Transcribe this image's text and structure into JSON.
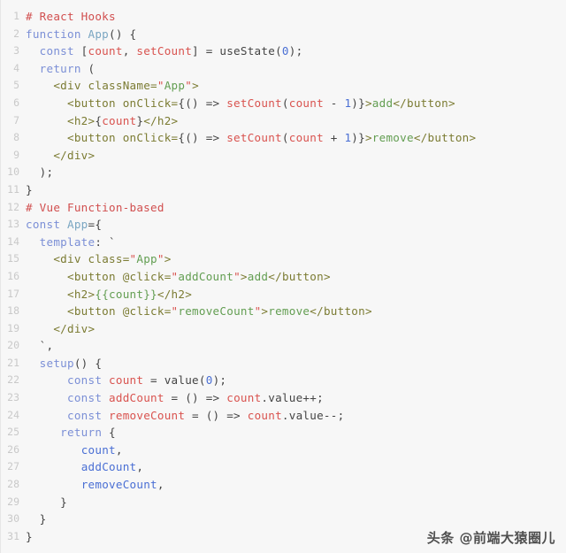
{
  "editor": {
    "language": "javascript",
    "background_color": "#f7f7f7",
    "line_number_color": "#c9c9c9",
    "default_text_color": "#404040",
    "total_lines": 31
  },
  "watermark": {
    "text": "头条 @前端大猿圈儿"
  },
  "lines": [
    {
      "n": "1",
      "tokens": [
        {
          "t": "# React Hooks",
          "c": "t-com"
        }
      ]
    },
    {
      "n": "2",
      "tokens": [
        {
          "t": "function ",
          "c": "t-kw"
        },
        {
          "t": "App",
          "c": "t-fnname"
        },
        {
          "t": "() {",
          "c": "t-plain"
        }
      ]
    },
    {
      "n": "3",
      "tokens": [
        {
          "t": "  ",
          "c": "t-plain"
        },
        {
          "t": "const",
          "c": "t-kw"
        },
        {
          "t": " [",
          "c": "t-plain"
        },
        {
          "t": "count",
          "c": "t-var"
        },
        {
          "t": ", ",
          "c": "t-plain"
        },
        {
          "t": "setCount",
          "c": "t-var"
        },
        {
          "t": "] = ",
          "c": "t-plain"
        },
        {
          "t": "useState",
          "c": "t-plain"
        },
        {
          "t": "(",
          "c": "t-plain"
        },
        {
          "t": "0",
          "c": "t-num"
        },
        {
          "t": ");",
          "c": "t-plain"
        }
      ]
    },
    {
      "n": "4",
      "tokens": [
        {
          "t": "  ",
          "c": "t-plain"
        },
        {
          "t": "return",
          "c": "t-kw"
        },
        {
          "t": " (",
          "c": "t-plain"
        }
      ]
    },
    {
      "n": "5",
      "tokens": [
        {
          "t": "    ",
          "c": "t-plain"
        },
        {
          "t": "<div",
          "c": "t-tag"
        },
        {
          "t": " className=",
          "c": "t-attr"
        },
        {
          "t": "\"",
          "c": "t-quote"
        },
        {
          "t": "App",
          "c": "t-str"
        },
        {
          "t": "\"",
          "c": "t-quote"
        },
        {
          "t": ">",
          "c": "t-tag"
        }
      ]
    },
    {
      "n": "6",
      "tokens": [
        {
          "t": "      ",
          "c": "t-plain"
        },
        {
          "t": "<button",
          "c": "t-tag"
        },
        {
          "t": " onClick=",
          "c": "t-attr"
        },
        {
          "t": "{() => ",
          "c": "t-plain"
        },
        {
          "t": "setCount",
          "c": "t-var"
        },
        {
          "t": "(",
          "c": "t-plain"
        },
        {
          "t": "count",
          "c": "t-var"
        },
        {
          "t": " - ",
          "c": "t-plain"
        },
        {
          "t": "1",
          "c": "t-num"
        },
        {
          "t": ")}",
          "c": "t-plain"
        },
        {
          "t": ">",
          "c": "t-tag"
        },
        {
          "t": "add",
          "c": "t-str"
        },
        {
          "t": "</button>",
          "c": "t-tag"
        }
      ]
    },
    {
      "n": "7",
      "tokens": [
        {
          "t": "      ",
          "c": "t-plain"
        },
        {
          "t": "<h2>",
          "c": "t-tag"
        },
        {
          "t": "{",
          "c": "t-plain"
        },
        {
          "t": "count",
          "c": "t-var"
        },
        {
          "t": "}",
          "c": "t-plain"
        },
        {
          "t": "</h2>",
          "c": "t-tag"
        }
      ]
    },
    {
      "n": "8",
      "tokens": [
        {
          "t": "      ",
          "c": "t-plain"
        },
        {
          "t": "<button",
          "c": "t-tag"
        },
        {
          "t": " onClick=",
          "c": "t-attr"
        },
        {
          "t": "{() => ",
          "c": "t-plain"
        },
        {
          "t": "setCount",
          "c": "t-var"
        },
        {
          "t": "(",
          "c": "t-plain"
        },
        {
          "t": "count",
          "c": "t-var"
        },
        {
          "t": " + ",
          "c": "t-plain"
        },
        {
          "t": "1",
          "c": "t-num"
        },
        {
          "t": ")}",
          "c": "t-plain"
        },
        {
          "t": ">",
          "c": "t-tag"
        },
        {
          "t": "remove",
          "c": "t-str"
        },
        {
          "t": "</button>",
          "c": "t-tag"
        }
      ]
    },
    {
      "n": "9",
      "tokens": [
        {
          "t": "    ",
          "c": "t-plain"
        },
        {
          "t": "</div>",
          "c": "t-tag"
        }
      ]
    },
    {
      "n": "10",
      "tokens": [
        {
          "t": "  );",
          "c": "t-plain"
        }
      ]
    },
    {
      "n": "11",
      "tokens": [
        {
          "t": "}",
          "c": "t-plain"
        }
      ]
    },
    {
      "n": "12",
      "tokens": [
        {
          "t": "# Vue Function-based",
          "c": "t-com"
        }
      ]
    },
    {
      "n": "13",
      "tokens": [
        {
          "t": "const",
          "c": "t-kw"
        },
        {
          "t": " ",
          "c": "t-plain"
        },
        {
          "t": "App",
          "c": "t-fnname"
        },
        {
          "t": "={",
          "c": "t-plain"
        }
      ]
    },
    {
      "n": "14",
      "tokens": [
        {
          "t": "  ",
          "c": "t-plain"
        },
        {
          "t": "template",
          "c": "t-kw"
        },
        {
          "t": ": `",
          "c": "t-plain"
        }
      ]
    },
    {
      "n": "15",
      "tokens": [
        {
          "t": "    ",
          "c": "t-plain"
        },
        {
          "t": "<div",
          "c": "t-tag"
        },
        {
          "t": " class=",
          "c": "t-attr"
        },
        {
          "t": "\"",
          "c": "t-quote"
        },
        {
          "t": "App",
          "c": "t-str"
        },
        {
          "t": "\"",
          "c": "t-quote"
        },
        {
          "t": ">",
          "c": "t-tag"
        }
      ]
    },
    {
      "n": "16",
      "tokens": [
        {
          "t": "      ",
          "c": "t-plain"
        },
        {
          "t": "<button",
          "c": "t-tag"
        },
        {
          "t": " @click=",
          "c": "t-attr"
        },
        {
          "t": "\"",
          "c": "t-quote"
        },
        {
          "t": "addCount",
          "c": "t-str"
        },
        {
          "t": "\"",
          "c": "t-quote"
        },
        {
          "t": ">",
          "c": "t-tag"
        },
        {
          "t": "add",
          "c": "t-str"
        },
        {
          "t": "</button>",
          "c": "t-tag"
        }
      ]
    },
    {
      "n": "17",
      "tokens": [
        {
          "t": "      ",
          "c": "t-plain"
        },
        {
          "t": "<h2>",
          "c": "t-tag"
        },
        {
          "t": "{{count}}",
          "c": "t-str"
        },
        {
          "t": "</h2>",
          "c": "t-tag"
        }
      ]
    },
    {
      "n": "18",
      "tokens": [
        {
          "t": "      ",
          "c": "t-plain"
        },
        {
          "t": "<button",
          "c": "t-tag"
        },
        {
          "t": " @click=",
          "c": "t-attr"
        },
        {
          "t": "\"",
          "c": "t-quote"
        },
        {
          "t": "removeCount",
          "c": "t-str"
        },
        {
          "t": "\"",
          "c": "t-quote"
        },
        {
          "t": ">",
          "c": "t-tag"
        },
        {
          "t": "remove",
          "c": "t-str"
        },
        {
          "t": "</button>",
          "c": "t-tag"
        }
      ]
    },
    {
      "n": "19",
      "tokens": [
        {
          "t": "    ",
          "c": "t-plain"
        },
        {
          "t": "</div>",
          "c": "t-tag"
        }
      ]
    },
    {
      "n": "20",
      "tokens": [
        {
          "t": "  `,",
          "c": "t-plain"
        }
      ]
    },
    {
      "n": "21",
      "tokens": [
        {
          "t": "  ",
          "c": "t-plain"
        },
        {
          "t": "setup",
          "c": "t-kw"
        },
        {
          "t": "() {",
          "c": "t-plain"
        }
      ]
    },
    {
      "n": "22",
      "tokens": [
        {
          "t": "      ",
          "c": "t-plain"
        },
        {
          "t": "const",
          "c": "t-kw"
        },
        {
          "t": " ",
          "c": "t-plain"
        },
        {
          "t": "count",
          "c": "t-var"
        },
        {
          "t": " = ",
          "c": "t-plain"
        },
        {
          "t": "value",
          "c": "t-plain"
        },
        {
          "t": "(",
          "c": "t-plain"
        },
        {
          "t": "0",
          "c": "t-num"
        },
        {
          "t": ");",
          "c": "t-plain"
        }
      ]
    },
    {
      "n": "23",
      "tokens": [
        {
          "t": "      ",
          "c": "t-plain"
        },
        {
          "t": "const",
          "c": "t-kw"
        },
        {
          "t": " ",
          "c": "t-plain"
        },
        {
          "t": "addCount",
          "c": "t-var"
        },
        {
          "t": " = () => ",
          "c": "t-plain"
        },
        {
          "t": "count",
          "c": "t-var"
        },
        {
          "t": ".value++;",
          "c": "t-plain"
        }
      ]
    },
    {
      "n": "24",
      "tokens": [
        {
          "t": "      ",
          "c": "t-plain"
        },
        {
          "t": "const",
          "c": "t-kw"
        },
        {
          "t": " ",
          "c": "t-plain"
        },
        {
          "t": "removeCount",
          "c": "t-var"
        },
        {
          "t": " = () => ",
          "c": "t-plain"
        },
        {
          "t": "count",
          "c": "t-var"
        },
        {
          "t": ".value--;",
          "c": "t-plain"
        }
      ]
    },
    {
      "n": "25",
      "tokens": [
        {
          "t": "     ",
          "c": "t-plain"
        },
        {
          "t": "return",
          "c": "t-kw"
        },
        {
          "t": " {",
          "c": "t-plain"
        }
      ]
    },
    {
      "n": "26",
      "tokens": [
        {
          "t": "        ",
          "c": "t-plain"
        },
        {
          "t": "count",
          "c": "t-blue"
        },
        {
          "t": ",",
          "c": "t-plain"
        }
      ]
    },
    {
      "n": "27",
      "tokens": [
        {
          "t": "        ",
          "c": "t-plain"
        },
        {
          "t": "addCount",
          "c": "t-blue"
        },
        {
          "t": ",",
          "c": "t-plain"
        }
      ]
    },
    {
      "n": "28",
      "tokens": [
        {
          "t": "        ",
          "c": "t-plain"
        },
        {
          "t": "removeCount",
          "c": "t-blue"
        },
        {
          "t": ",",
          "c": "t-plain"
        }
      ]
    },
    {
      "n": "29",
      "tokens": [
        {
          "t": "     }",
          "c": "t-plain"
        }
      ]
    },
    {
      "n": "30",
      "tokens": [
        {
          "t": "  }",
          "c": "t-plain"
        }
      ]
    },
    {
      "n": "31",
      "tokens": [
        {
          "t": "}",
          "c": "t-plain"
        }
      ]
    }
  ]
}
